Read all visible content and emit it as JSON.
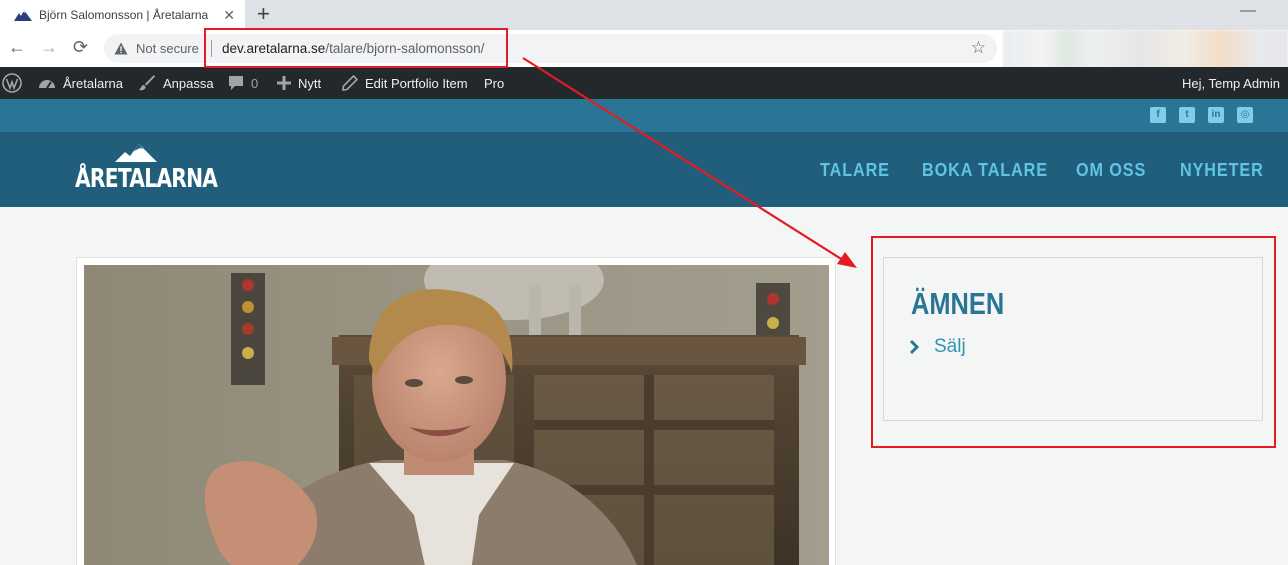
{
  "browser": {
    "tab_title": "Björn Salomonsson | Åretalarna",
    "new_tab_icon": "plus-icon",
    "not_secure_label": "Not secure",
    "url_host": "dev.aretalarna.se",
    "url_path": "/talare/bjorn-salomonsson/"
  },
  "adminbar": {
    "site_name": "Åretalarna",
    "customize": "Anpassa",
    "comments_count": "0",
    "new_label": "Nytt",
    "edit_label": "Edit Portfolio Item",
    "pro_label": "Pro",
    "howdy": "Hej, Temp Admin"
  },
  "site": {
    "logo_text": "ÅRETALARNA",
    "nav": [
      "TALARE",
      "BOKA TALARE",
      "OM OSS",
      "NYHETER"
    ],
    "social_icons": [
      "facebook-icon",
      "twitter-icon",
      "linkedin-icon",
      "instagram-icon"
    ]
  },
  "widget": {
    "title": "ÄMNEN",
    "items": [
      "Sälj"
    ]
  },
  "colors": {
    "accent": "#2a7595",
    "header": "#215e7b",
    "nav_text": "#5fc5e3",
    "annotation": "#e51b23"
  }
}
